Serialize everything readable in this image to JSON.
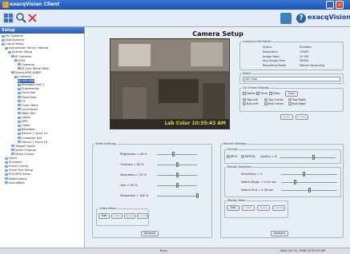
{
  "window": {
    "title": "exacqVision Client"
  },
  "brand": {
    "name": "exacqVision"
  },
  "sidebar": {
    "header": "Setup",
    "items": [
      {
        "label": "My Systems"
      },
      {
        "label": "Add Systems"
      },
      {
        "label": "Group Setup"
      },
      {
        "label": "exacqVision Server Internal"
      },
      {
        "label": "System Setup"
      },
      {
        "label": "IP Cameras"
      },
      {
        "label": "AXIS"
      },
      {
        "label": "Cameras"
      },
      {
        "label": "IP Cam Wired 360v"
      },
      {
        "label": "Exacq ARM 4080P"
      },
      {
        "label": "Cameras"
      },
      {
        "label": "Lab color"
      },
      {
        "label": "Backdoor Hall 1"
      },
      {
        "label": "Engineering"
      },
      {
        "label": "Front Hall"
      },
      {
        "label": "Front Door"
      },
      {
        "label": "TV"
      },
      {
        "label": "Color Stairs"
      },
      {
        "label": "Lunchroom"
      },
      {
        "label": "West Hall"
      },
      {
        "label": "Lobby"
      },
      {
        "label": "SMS"
      },
      {
        "label": "Cable"
      },
      {
        "label": "Backdoor"
      },
      {
        "label": "Device 1 Input 14"
      },
      {
        "label": "Customer Hall"
      },
      {
        "label": "Device 1 Input 16"
      },
      {
        "label": "Trigger Inputs"
      },
      {
        "label": "Alarm Outputs"
      },
      {
        "label": "Video Output"
      },
      {
        "label": "Users"
      },
      {
        "label": "Schedule"
      },
      {
        "label": "Event Linking"
      },
      {
        "label": "Serial Port Setup"
      },
      {
        "label": "POS/ATM Setup"
      },
      {
        "label": "Notifications"
      },
      {
        "label": "exacqReell"
      }
    ]
  },
  "main": {
    "title": "Camera Setup",
    "video_timestamp": "Lab Color 10:35:43 AM",
    "camera_info": {
      "title": "Camera Information",
      "rows": [
        {
          "key": "Status",
          "value": "Enabled"
        },
        {
          "key": "Resolution",
          "value": "1080P"
        },
        {
          "key": "Image Rate",
          "value": "25 IPS"
        },
        {
          "key": "Avg Image Size",
          "value": "58000"
        },
        {
          "key": "Recording Mode",
          "value": "Motion Recording"
        }
      ]
    },
    "name": {
      "title": "Name",
      "value": "Lab color"
    },
    "osd": {
      "title": "On Screen Display",
      "checks": [
        "Name",
        "Time",
        "Date"
      ],
      "font_button": "Font",
      "positions": [
        "Top-Left",
        "Top-Center",
        "Top-Right",
        "Bot-Left",
        "Bot-Center",
        "Bot-Right"
      ],
      "apply": "Apply",
      "cancel": "Cancel"
    },
    "video_settings": {
      "title": "Video Settings",
      "sliders": [
        {
          "label": "Brightness = 40 %",
          "value": 40
        },
        {
          "label": "Contrast = 50 %",
          "value": 50
        },
        {
          "label": "Saturation = 50 %",
          "value": 50
        },
        {
          "label": "Hue = 50 %",
          "value": 50
        },
        {
          "label": "Sharpness = 100 %",
          "value": 100
        }
      ],
      "mask_title": "Video Mask",
      "buttons": [
        "Edit",
        "Clear",
        "Apply",
        "Cancel"
      ],
      "defaults": "Defaults"
    },
    "record_settings": {
      "title": "Record Settings",
      "format_title": "Format",
      "formats": [
        "JPEG",
        "MPEG4"
      ],
      "quality_label": "Quality = 6",
      "quality_value": 60,
      "motion_title": "Motion Detection",
      "sliders": [
        {
          "label": "Sensitivity = 4",
          "value": 40
        },
        {
          "label": "Switch Begin = 0.25 sec",
          "value": 25
        },
        {
          "label": "Switch End = 5.00 sec",
          "value": 50
        }
      ],
      "mask_title": "Motion Mask",
      "buttons": [
        "Edit",
        "Clear",
        "Apply",
        "Cancel"
      ],
      "defaults": "Defaults"
    }
  },
  "statusbar": {
    "left": "Busy",
    "right": "Wed Oct 25, 2006 10:35:43 AM"
  }
}
